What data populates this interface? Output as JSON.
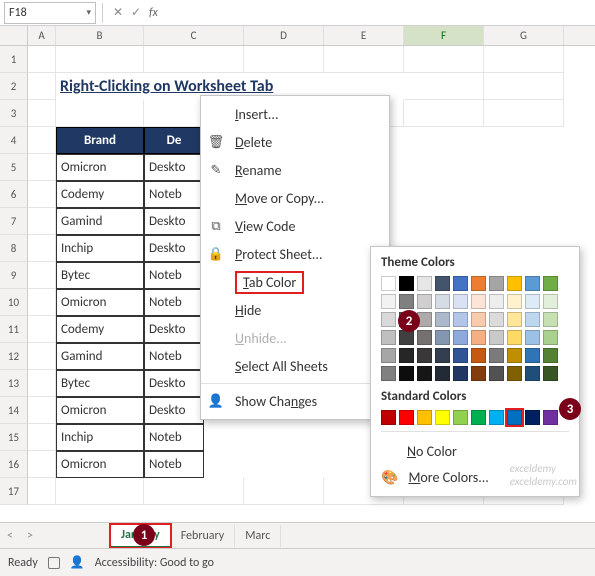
{
  "namebox": {
    "ref": "F18",
    "chev": "▾"
  },
  "fx": {
    "cancel": "✕",
    "check": "✓",
    "label": "fx"
  },
  "cols": [
    "",
    "A",
    "B",
    "C",
    "D",
    "E",
    "F",
    "G"
  ],
  "title": "Right-Clicking on Worksheet Tab",
  "headers": [
    "Brand",
    "De"
  ],
  "rows": [
    [
      "Omicron",
      "Deskto"
    ],
    [
      "Codemy",
      "Noteb"
    ],
    [
      "Gamind",
      "Deskto"
    ],
    [
      "Inchip",
      "Deskto"
    ],
    [
      "Bytec",
      "Noteb"
    ],
    [
      "Omicron",
      "Noteb"
    ],
    [
      "Codemy",
      "Deskto"
    ],
    [
      "Gamind",
      "Noteb"
    ],
    [
      "Bytec",
      "Deskto"
    ],
    [
      "Omicron",
      "Deskto"
    ],
    [
      "Inchip",
      "Noteb"
    ],
    [
      "Omicron",
      "Noteb"
    ]
  ],
  "sheettabs": {
    "nav_prev": "<",
    "nav_next": ">",
    "active": "January",
    "t2": "February",
    "t3": "Marc"
  },
  "status": {
    "ready": "Ready",
    "acc": "Accessibility: Good to go"
  },
  "menu": {
    "insert": "Insert...",
    "delete": "Delete",
    "rename": "Rename",
    "move": "Move or Copy...",
    "viewcode": "View Code",
    "protect": "Protect Sheet...",
    "tabcolor": "Tab Color",
    "hide": "Hide",
    "unhide": "Unhide...",
    "selectall": "Select All Sheets",
    "showchanges": "Show Changes"
  },
  "colorpop": {
    "theme_title": "Theme Colors",
    "standard_title": "Standard Colors",
    "nocolor": "No Color",
    "morecolors": "More Colors...",
    "theme_top": [
      "#ffffff",
      "#000000",
      "#e7e6e6",
      "#44546a",
      "#4472c4",
      "#ed7d31",
      "#a5a5a5",
      "#ffc000",
      "#5b9bd5",
      "#70ad47"
    ],
    "theme_shades": [
      [
        "#f2f2f2",
        "#808080",
        "#d0cece",
        "#d6dce4",
        "#d9e1f2",
        "#fce4d6",
        "#ededed",
        "#fff2cc",
        "#ddebf7",
        "#e2efda"
      ],
      [
        "#d9d9d9",
        "#595959",
        "#aeaaaa",
        "#acb9ca",
        "#b4c6e7",
        "#f8cbad",
        "#dbdbdb",
        "#ffe699",
        "#bdd7ee",
        "#c6e0b4"
      ],
      [
        "#bfbfbf",
        "#404040",
        "#757171",
        "#8497b0",
        "#8ea9db",
        "#f4b084",
        "#c9c9c9",
        "#ffd966",
        "#9bc2e6",
        "#a9d08e"
      ],
      [
        "#a6a6a6",
        "#262626",
        "#3a3838",
        "#333f4f",
        "#305496",
        "#c65911",
        "#7b7b7b",
        "#bf8f00",
        "#2f75b5",
        "#548235"
      ],
      [
        "#808080",
        "#0d0d0d",
        "#161616",
        "#222b35",
        "#203764",
        "#833c0c",
        "#525252",
        "#806000",
        "#1f4e78",
        "#375623"
      ]
    ],
    "standard": [
      "#c00000",
      "#ff0000",
      "#ffc000",
      "#ffff00",
      "#92d050",
      "#00b050",
      "#00b0f0",
      "#0070c0",
      "#002060",
      "#7030a0"
    ]
  },
  "badges": {
    "b1": "1",
    "b2": "2",
    "b3": "3"
  },
  "watermark": "exceldemy"
}
